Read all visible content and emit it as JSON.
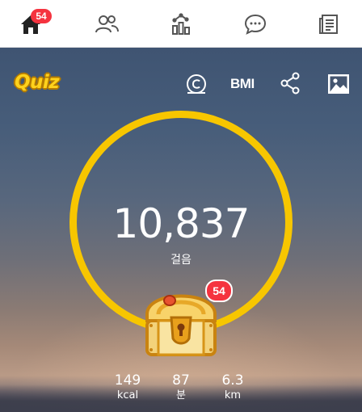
{
  "nav": {
    "items": [
      {
        "name": "home",
        "icon": "home-icon"
      },
      {
        "name": "friends",
        "icon": "people-icon"
      },
      {
        "name": "stats",
        "icon": "chart-icon"
      },
      {
        "name": "chat",
        "icon": "chat-bubble-icon"
      },
      {
        "name": "news",
        "icon": "newspaper-icon"
      }
    ],
    "home_badge": "54"
  },
  "toolbar": {
    "quiz_label": "Quiz",
    "coin_icon": "coin-icon",
    "bmi_label": "BMI",
    "share_icon": "share-icon",
    "photo_icon": "image-icon"
  },
  "steps": {
    "value": "10,837",
    "label": "걸음"
  },
  "chest": {
    "icon": "treasure-chest-icon",
    "badge": "54"
  },
  "stats": [
    {
      "value": "149",
      "unit": "kcal"
    },
    {
      "value": "87",
      "unit": "분"
    },
    {
      "value": "6.3",
      "unit": "km"
    }
  ],
  "colors": {
    "accent": "#f7c600",
    "badge": "#f5333f",
    "nav_icon": "#555555"
  }
}
